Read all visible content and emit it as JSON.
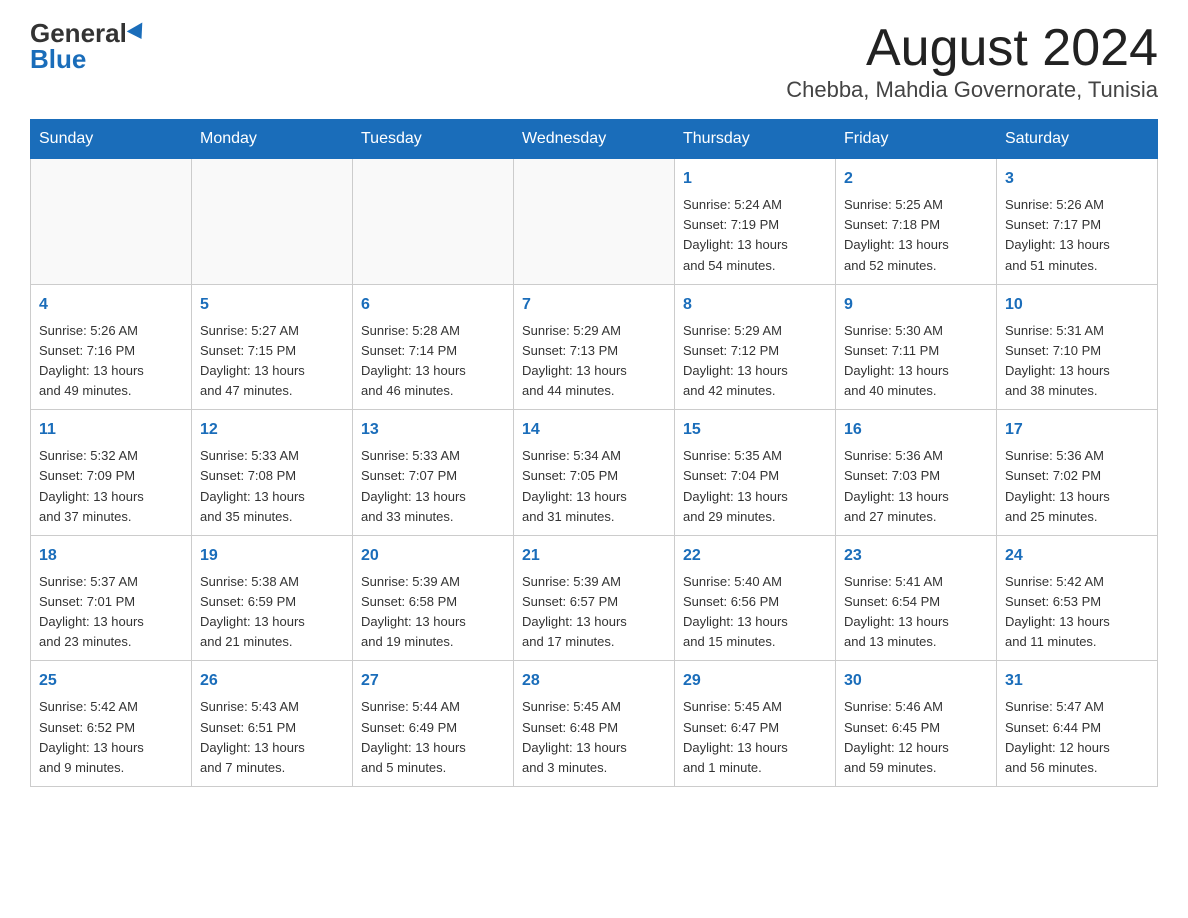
{
  "header": {
    "logo_general": "General",
    "logo_blue": "Blue",
    "month_title": "August 2024",
    "location": "Chebba, Mahdia Governorate, Tunisia"
  },
  "days_of_week": [
    "Sunday",
    "Monday",
    "Tuesday",
    "Wednesday",
    "Thursday",
    "Friday",
    "Saturday"
  ],
  "weeks": [
    {
      "days": [
        {
          "date": "",
          "info": ""
        },
        {
          "date": "",
          "info": ""
        },
        {
          "date": "",
          "info": ""
        },
        {
          "date": "",
          "info": ""
        },
        {
          "date": "1",
          "info": "Sunrise: 5:24 AM\nSunset: 7:19 PM\nDaylight: 13 hours\nand 54 minutes."
        },
        {
          "date": "2",
          "info": "Sunrise: 5:25 AM\nSunset: 7:18 PM\nDaylight: 13 hours\nand 52 minutes."
        },
        {
          "date": "3",
          "info": "Sunrise: 5:26 AM\nSunset: 7:17 PM\nDaylight: 13 hours\nand 51 minutes."
        }
      ]
    },
    {
      "days": [
        {
          "date": "4",
          "info": "Sunrise: 5:26 AM\nSunset: 7:16 PM\nDaylight: 13 hours\nand 49 minutes."
        },
        {
          "date": "5",
          "info": "Sunrise: 5:27 AM\nSunset: 7:15 PM\nDaylight: 13 hours\nand 47 minutes."
        },
        {
          "date": "6",
          "info": "Sunrise: 5:28 AM\nSunset: 7:14 PM\nDaylight: 13 hours\nand 46 minutes."
        },
        {
          "date": "7",
          "info": "Sunrise: 5:29 AM\nSunset: 7:13 PM\nDaylight: 13 hours\nand 44 minutes."
        },
        {
          "date": "8",
          "info": "Sunrise: 5:29 AM\nSunset: 7:12 PM\nDaylight: 13 hours\nand 42 minutes."
        },
        {
          "date": "9",
          "info": "Sunrise: 5:30 AM\nSunset: 7:11 PM\nDaylight: 13 hours\nand 40 minutes."
        },
        {
          "date": "10",
          "info": "Sunrise: 5:31 AM\nSunset: 7:10 PM\nDaylight: 13 hours\nand 38 minutes."
        }
      ]
    },
    {
      "days": [
        {
          "date": "11",
          "info": "Sunrise: 5:32 AM\nSunset: 7:09 PM\nDaylight: 13 hours\nand 37 minutes."
        },
        {
          "date": "12",
          "info": "Sunrise: 5:33 AM\nSunset: 7:08 PM\nDaylight: 13 hours\nand 35 minutes."
        },
        {
          "date": "13",
          "info": "Sunrise: 5:33 AM\nSunset: 7:07 PM\nDaylight: 13 hours\nand 33 minutes."
        },
        {
          "date": "14",
          "info": "Sunrise: 5:34 AM\nSunset: 7:05 PM\nDaylight: 13 hours\nand 31 minutes."
        },
        {
          "date": "15",
          "info": "Sunrise: 5:35 AM\nSunset: 7:04 PM\nDaylight: 13 hours\nand 29 minutes."
        },
        {
          "date": "16",
          "info": "Sunrise: 5:36 AM\nSunset: 7:03 PM\nDaylight: 13 hours\nand 27 minutes."
        },
        {
          "date": "17",
          "info": "Sunrise: 5:36 AM\nSunset: 7:02 PM\nDaylight: 13 hours\nand 25 minutes."
        }
      ]
    },
    {
      "days": [
        {
          "date": "18",
          "info": "Sunrise: 5:37 AM\nSunset: 7:01 PM\nDaylight: 13 hours\nand 23 minutes."
        },
        {
          "date": "19",
          "info": "Sunrise: 5:38 AM\nSunset: 6:59 PM\nDaylight: 13 hours\nand 21 minutes."
        },
        {
          "date": "20",
          "info": "Sunrise: 5:39 AM\nSunset: 6:58 PM\nDaylight: 13 hours\nand 19 minutes."
        },
        {
          "date": "21",
          "info": "Sunrise: 5:39 AM\nSunset: 6:57 PM\nDaylight: 13 hours\nand 17 minutes."
        },
        {
          "date": "22",
          "info": "Sunrise: 5:40 AM\nSunset: 6:56 PM\nDaylight: 13 hours\nand 15 minutes."
        },
        {
          "date": "23",
          "info": "Sunrise: 5:41 AM\nSunset: 6:54 PM\nDaylight: 13 hours\nand 13 minutes."
        },
        {
          "date": "24",
          "info": "Sunrise: 5:42 AM\nSunset: 6:53 PM\nDaylight: 13 hours\nand 11 minutes."
        }
      ]
    },
    {
      "days": [
        {
          "date": "25",
          "info": "Sunrise: 5:42 AM\nSunset: 6:52 PM\nDaylight: 13 hours\nand 9 minutes."
        },
        {
          "date": "26",
          "info": "Sunrise: 5:43 AM\nSunset: 6:51 PM\nDaylight: 13 hours\nand 7 minutes."
        },
        {
          "date": "27",
          "info": "Sunrise: 5:44 AM\nSunset: 6:49 PM\nDaylight: 13 hours\nand 5 minutes."
        },
        {
          "date": "28",
          "info": "Sunrise: 5:45 AM\nSunset: 6:48 PM\nDaylight: 13 hours\nand 3 minutes."
        },
        {
          "date": "29",
          "info": "Sunrise: 5:45 AM\nSunset: 6:47 PM\nDaylight: 13 hours\nand 1 minute."
        },
        {
          "date": "30",
          "info": "Sunrise: 5:46 AM\nSunset: 6:45 PM\nDaylight: 12 hours\nand 59 minutes."
        },
        {
          "date": "31",
          "info": "Sunrise: 5:47 AM\nSunset: 6:44 PM\nDaylight: 12 hours\nand 56 minutes."
        }
      ]
    }
  ]
}
